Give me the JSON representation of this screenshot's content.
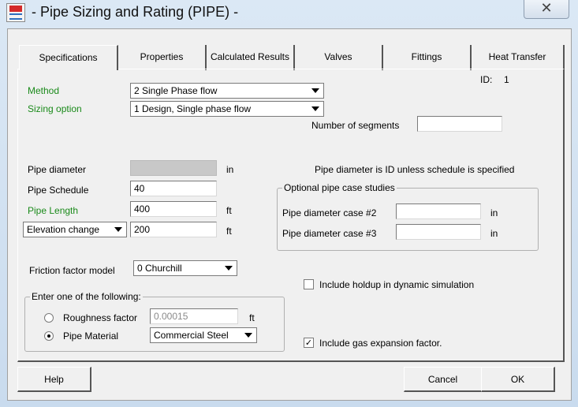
{
  "window": {
    "title": " - Pipe Sizing and Rating (PIPE)  -",
    "close_glyph": "✕"
  },
  "tabs": [
    {
      "label": "Specifications",
      "active": true
    },
    {
      "label": "Properties"
    },
    {
      "label": "Calculated Results"
    },
    {
      "label": "Valves"
    },
    {
      "label": "Fittings"
    },
    {
      "label": "Heat Transfer"
    }
  ],
  "specs": {
    "id_label": "ID:",
    "id_value": "1",
    "method": {
      "label": "Method",
      "value": "2 Single Phase flow"
    },
    "sizing_option": {
      "label": "Sizing option",
      "value": "1 Design, Single phase flow"
    },
    "segments": {
      "label": "Number of segments",
      "value": ""
    },
    "pipe_diameter": {
      "label": "Pipe diameter",
      "value": "",
      "unit": "in"
    },
    "diameter_note": "Pipe diameter is ID unless schedule is specified",
    "pipe_schedule": {
      "label": "Pipe Schedule",
      "value": "40"
    },
    "pipe_length": {
      "label": "Pipe Length",
      "value": "400",
      "unit": "ft"
    },
    "elevation": {
      "label": "Elevation change",
      "value": "200",
      "unit": "ft"
    },
    "case_studies": {
      "title": "Optional pipe case studies",
      "case2": {
        "label": "Pipe diameter case #2",
        "value": "",
        "unit": "in"
      },
      "case3": {
        "label": "Pipe diameter case #3",
        "value": "",
        "unit": "in"
      }
    },
    "friction": {
      "label": "Friction factor model",
      "value": "0 Churchill"
    },
    "holdup": {
      "label": "Include holdup in dynamic simulation",
      "checked": false
    },
    "enter_one": {
      "title": "Enter one of the following:",
      "roughness": {
        "label": "Roughness factor",
        "value": "0.00015",
        "unit": "ft",
        "selected": false
      },
      "material": {
        "label": "Pipe Material",
        "value": "Commercial Steel",
        "selected": true
      }
    },
    "gas_expansion": {
      "label": "Include gas expansion factor.",
      "checked": true,
      "check_glyph": "✓"
    }
  },
  "buttons": {
    "help": "Help",
    "cancel": "Cancel",
    "ok": "OK"
  },
  "colors": {
    "green_label": "#1a8a1a",
    "window_frame": "#cfe0f0",
    "dialog_bg": "#f0f0f0"
  }
}
